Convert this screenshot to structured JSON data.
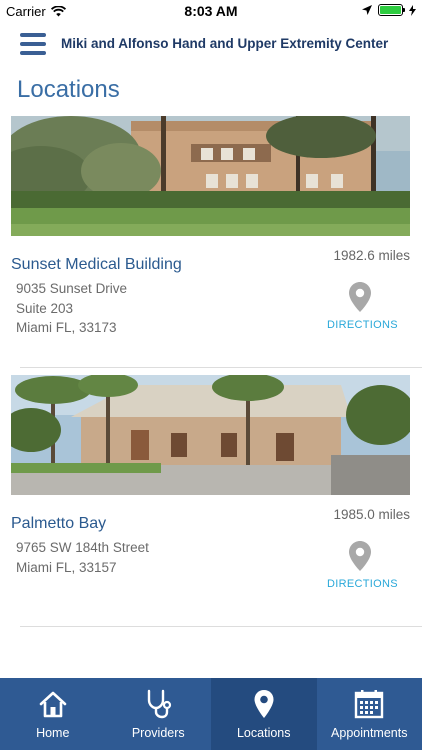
{
  "status_bar": {
    "carrier": "Carrier",
    "time": "8:03 AM"
  },
  "header": {
    "title": "Miki and Alfonso Hand and Upper Extremity Center",
    "menu_icon": "hamburger-menu-icon"
  },
  "page": {
    "title": "Locations"
  },
  "locations": [
    {
      "name": "Sunset Medical Building",
      "distance": "1982.6 miles",
      "address_line1": "9035 Sunset Drive",
      "address_line2": "Suite 203",
      "address_line3": "Miami FL, 33173",
      "directions_label": "DIRECTIONS",
      "icon": "map-pin-icon"
    },
    {
      "name": "Palmetto Bay",
      "distance": "1985.0 miles",
      "address_line1": "9765 SW 184th Street",
      "address_line2": "Miami FL, 33157",
      "directions_label": "DIRECTIONS",
      "icon": "map-pin-icon"
    }
  ],
  "tabs": [
    {
      "label": "Home",
      "icon": "home-icon"
    },
    {
      "label": "Providers",
      "icon": "stethoscope-icon"
    },
    {
      "label": "Locations",
      "icon": "map-pin-icon",
      "active": true
    },
    {
      "label": "Appointments",
      "icon": "calendar-icon"
    }
  ],
  "colors": {
    "header_title": "#1f3a66",
    "accent_blue": "#2b5a8f",
    "tab_bar": "#2f5a93",
    "directions": "#29a8d9"
  }
}
